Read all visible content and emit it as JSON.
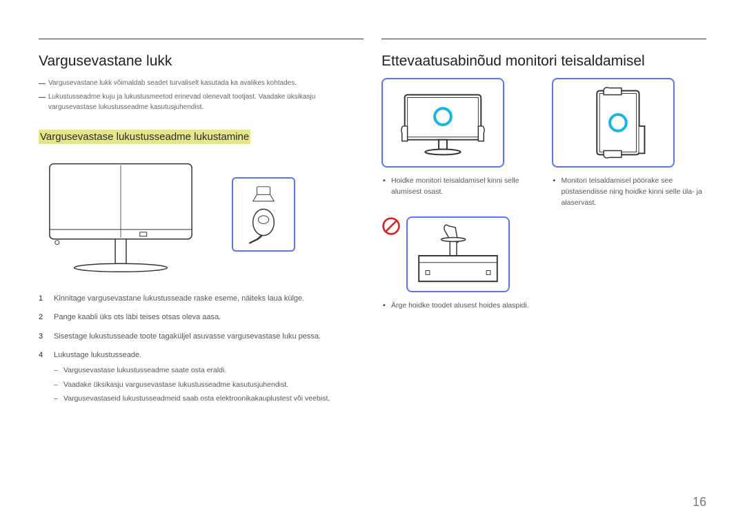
{
  "page_number": "16",
  "left": {
    "title": "Vargusevastane lukk",
    "notes": [
      "Vargusevastane lukk võimaldab seadet turvaliselt kasutada ka avalikes kohtades.",
      "Lukustusseadme kuju ja lukustusmeetod erinevad olenevalt tootjast. Vaadake üksikasju vargusevastase lukustusseadme kasutusjuhendist."
    ],
    "subheading": "Vargusevastase lukustusseadme lukustamine",
    "steps": [
      "Kinnitage vargusevastane lukustusseade raske eseme, näiteks laua külge.",
      "Pange kaabli üks ots läbi teises otsas oleva aasa.",
      "Sisestage lukustusseade toote tagaküljel asuvasse vargusevastase luku pessa.",
      "Lukustage lukustusseade."
    ],
    "substeps": [
      "Vargusevastase lukustusseadme saate osta eraldi.",
      "Vaadake üksikasju vargusevastase lukustusseadme kasutusjuhendist.",
      "Vargusevastaseid lukustusseadmeid saab osta elektroonikakauplustest või veebist."
    ]
  },
  "right": {
    "title": "Ettevaatusabinõud monitori teisaldamisel",
    "panels": [
      {
        "bullet": "Hoidke monitori teisaldamisel kinni selle alumisest osast."
      },
      {
        "bullet": "Monitori teisaldamisel pöörake see püstasendisse ning hoidke kinni selle üla- ja alaservast."
      }
    ],
    "prohibit_bullet": "Ärge hoidke toodet alusest hoides alaspidi."
  }
}
